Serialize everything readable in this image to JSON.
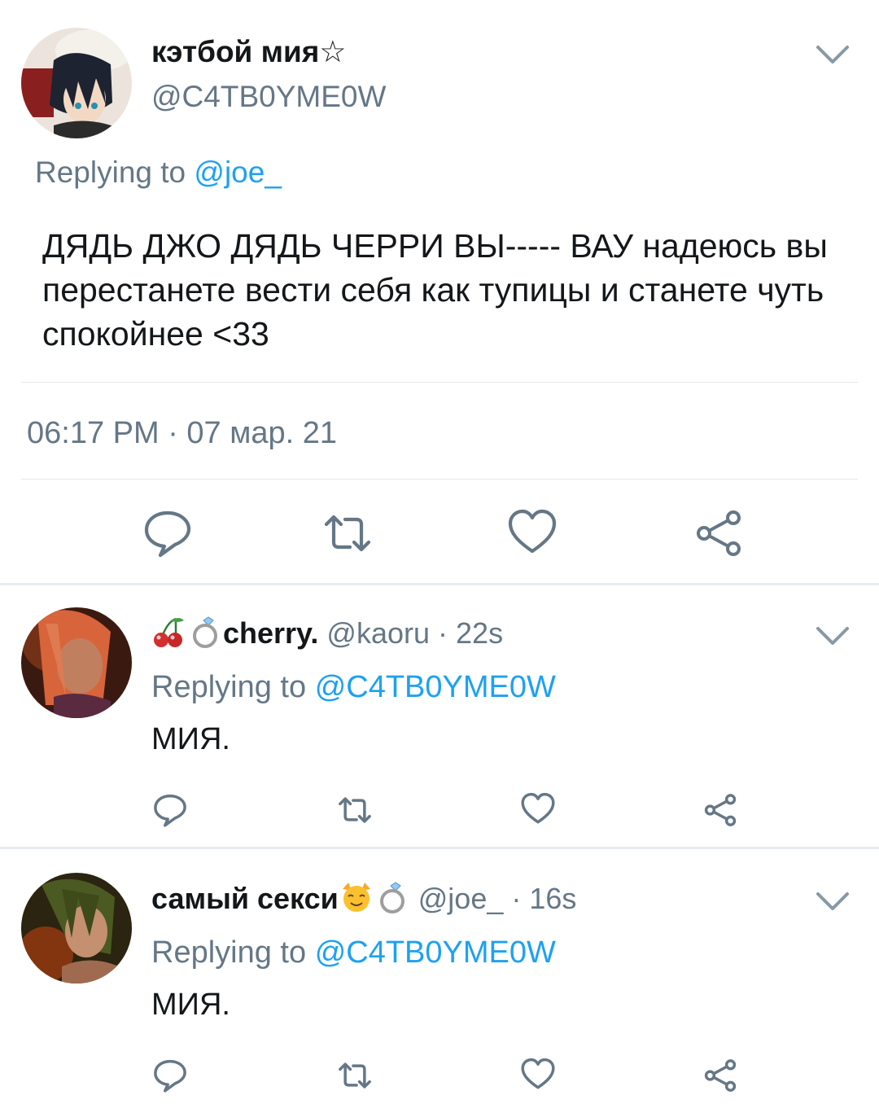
{
  "main_tweet": {
    "display_name": "кэтбой мия☆",
    "handle": "@C4TB0YME0W",
    "replying_prefix": "Replying to",
    "replying_to": "@joe_",
    "text": "ДЯДЬ ДЖО ДЯДЬ ЧЕРРИ ВЫ----- ВАУ надеюсь вы перестанете вести себя как тупицы и станете чуть спокойнее <33",
    "timestamp": "06:17 PM · 07 мар. 21"
  },
  "replies": [
    {
      "display_name": "cherry.",
      "name_emojis": [
        "cherries-emoji",
        "ring-emoji"
      ],
      "handle": "@kaoru",
      "age": "· 22s",
      "replying_prefix": "Replying to",
      "replying_to": "@C4TB0YME0W",
      "text": "МИЯ."
    },
    {
      "display_name": "самый секси",
      "name_emojis": [
        "cat-emoji",
        "ring-emoji"
      ],
      "handle": "@joe_",
      "age": "· 16s",
      "replying_prefix": "Replying to",
      "replying_to": "@C4TB0YME0W",
      "text": "МИЯ."
    }
  ],
  "icons": [
    "chevron-down-icon",
    "reply-icon",
    "retweet-icon",
    "like-icon",
    "share-icon"
  ],
  "colors": {
    "link": "#1da1f2",
    "secondary_text": "#657786",
    "icon": "#657786",
    "divider": "#e1e8ed"
  }
}
